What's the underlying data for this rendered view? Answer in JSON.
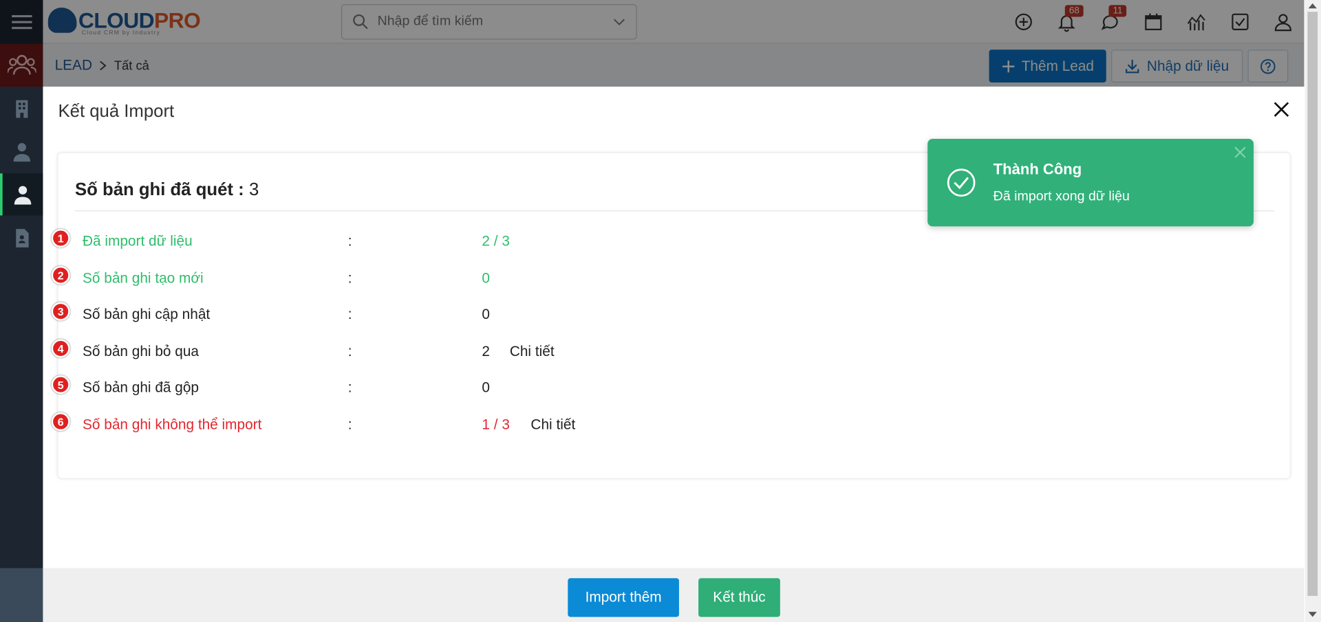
{
  "app": {
    "logo_cloud": "CLOUD",
    "logo_pro": "PRO",
    "logo_sub": "Cloud CRM by Industry"
  },
  "search": {
    "placeholder": "Nhập để tìm kiếm"
  },
  "header": {
    "notifications_count": "68",
    "messages_count": "11"
  },
  "breadcrumb": {
    "module": "LEAD",
    "current": "Tất cả"
  },
  "toolbar": {
    "add_label": "Thêm Lead",
    "import_label": "Nhập dữ liệu"
  },
  "modal": {
    "title": "Kết quả Import",
    "scanned_label": "Số bản ghi đã quét  :",
    "scanned_value": "3",
    "rows": [
      {
        "marker": "1",
        "label": "Đã import dữ liệu",
        "colon": ":",
        "value": "2 / 3",
        "detail": ""
      },
      {
        "marker": "2",
        "label": "Số bản ghi tạo mới",
        "colon": ":",
        "value": "0",
        "detail": ""
      },
      {
        "marker": "3",
        "label": "Số bản ghi cập nhật",
        "colon": ":",
        "value": "0",
        "detail": ""
      },
      {
        "marker": "4",
        "label": "Số bản ghi bỏ qua",
        "colon": ":",
        "value": "2",
        "detail": "Chi tiết"
      },
      {
        "marker": "5",
        "label": "Số bản ghi đã gộp",
        "colon": ":",
        "value": "0",
        "detail": ""
      },
      {
        "marker": "6",
        "label": "Số bản ghi không thể import",
        "colon": ":",
        "value": "1 / 3",
        "detail": "Chi tiết"
      }
    ]
  },
  "toast": {
    "title": "Thành Công",
    "message": "Đã import xong dữ liệu"
  },
  "footer": {
    "import_more_label": "Import thêm",
    "finish_label": "Kết thúc"
  },
  "colors": {
    "success": "#2ebd6b",
    "error": "#e3262f",
    "primary": "#0b73c6",
    "toast": "#31b07a"
  }
}
